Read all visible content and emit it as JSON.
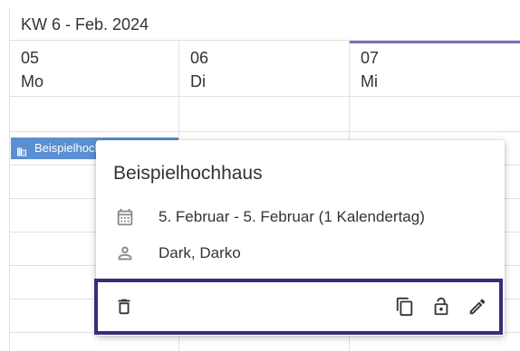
{
  "calendar": {
    "week_title": "KW 6 - Feb. 2024",
    "days": [
      {
        "num": "05",
        "name": "Mo",
        "today": false
      },
      {
        "num": "06",
        "name": "Di",
        "today": false
      },
      {
        "num": "07",
        "name": "Mi",
        "today": true
      }
    ],
    "today_color": "#7f6bc7"
  },
  "event_chip": {
    "label": "Beispielhochhaus",
    "color": "#5b8fd1",
    "icon": "building-icon"
  },
  "popup": {
    "title": "Beispielhochhaus",
    "date_text": "5. Februar - 5. Februar (1 Kalendertag)",
    "date_icon": "calendar-icon",
    "person_text": "Dark, Darko",
    "person_icon": "person-icon",
    "actions": [
      "delete-icon",
      "copy-icon",
      "lock-icon",
      "edit-icon"
    ],
    "actions_border_color": "#3d2a79"
  }
}
